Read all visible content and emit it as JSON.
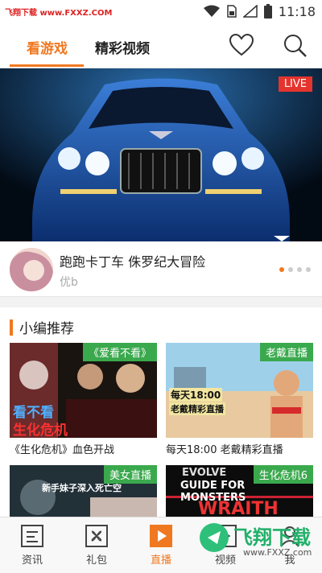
{
  "status_bar": {
    "watermark": "飞翔下载 www.FXXZ.COM",
    "time": "11:18"
  },
  "top_bar": {
    "tabs": [
      {
        "label": "看游戏",
        "active": true
      },
      {
        "label": "精彩视频",
        "active": false
      }
    ],
    "icons": [
      "heart-icon",
      "search-icon"
    ],
    "accent_color": "#f07820"
  },
  "banner": {
    "badge": "LIVE",
    "slide_count": 4,
    "active_slide": 1
  },
  "featured_stream": {
    "title": "跑跑卡丁车 侏罗纪大冒险",
    "streamer": "优b"
  },
  "recommend": {
    "title": "小编推荐",
    "cards": [
      {
        "tag": "《爱看不看》",
        "caption": "《生化危机》血色开战",
        "thumb_text_1": "看不看",
        "thumb_text_2": "生化危机"
      },
      {
        "tag": "老戴直播",
        "caption": "每天18:00 老戴精彩直播",
        "thumb_text_1": "每天18:00",
        "thumb_text_2": "老戴精彩直播"
      },
      {
        "tag": "美女直播",
        "caption": "",
        "thumb_text_1": "新手妹子深入死亡空"
      },
      {
        "tag": "生化危机6",
        "caption": "",
        "thumb_text_1": "GUIDE FOR MONSTERS",
        "thumb_text_2": "WRAITH",
        "thumb_text_3": "EVOLVE"
      }
    ]
  },
  "bottom_nav": {
    "items": [
      {
        "label": "资讯",
        "icon": "news-icon",
        "active": false
      },
      {
        "label": "礼包",
        "icon": "gift-icon",
        "active": false
      },
      {
        "label": "直播",
        "icon": "play-icon",
        "active": true
      },
      {
        "label": "视频",
        "icon": "video-icon",
        "active": false
      },
      {
        "label": "我",
        "icon": "profile-icon",
        "active": false
      }
    ]
  },
  "watermark_bottom": {
    "text": "飞翔下载",
    "url": "www.FXXZ.com"
  }
}
